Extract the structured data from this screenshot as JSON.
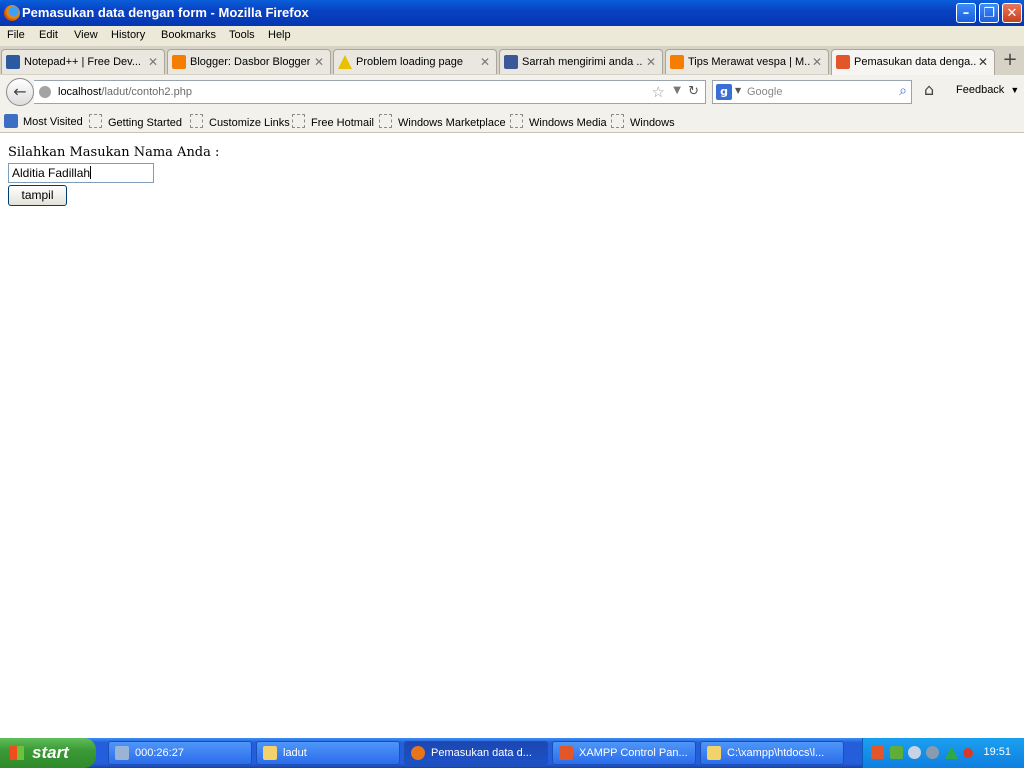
{
  "window": {
    "title": "Pemasukan data dengan form - Mozilla Firefox",
    "minimize": "–",
    "restore": "❐",
    "close": "✕"
  },
  "menu": [
    "File",
    "Edit",
    "View",
    "History",
    "Bookmarks",
    "Tools",
    "Help"
  ],
  "tabs": [
    {
      "label": "Notepad++ | Free Dev...",
      "icon": "sourceforge-icon",
      "color": "#2c5aa0"
    },
    {
      "label": "Blogger: Dasbor Blogger",
      "icon": "blogger-icon",
      "color": "#f57d00"
    },
    {
      "label": "Problem loading page",
      "icon": "warning-icon",
      "color": "#e8c200"
    },
    {
      "label": "Sarrah mengirimi anda ...",
      "icon": "facebook-icon",
      "color": "#3b5998"
    },
    {
      "label": "Tips Merawat vespa | M...",
      "icon": "blogger-icon",
      "color": "#f57d00"
    },
    {
      "label": "Pemasukan data denga...",
      "icon": "xampp-icon",
      "color": "#e2562a"
    }
  ],
  "nav": {
    "url_host": "localhost",
    "url_path": "/ladut/contoh2.php",
    "search_placeholder": "Google",
    "feedback": "Feedback"
  },
  "bookmarks": [
    "Most Visited",
    "Getting Started",
    "Customize Links",
    "Free Hotmail",
    "Windows Marketplace",
    "Windows Media",
    "Windows"
  ],
  "page": {
    "label": "Silahkan Masukan Nama Anda :",
    "input_value": "Alditia Fadillah",
    "button": "tampil"
  },
  "taskbar": {
    "start": "start",
    "tasks": [
      {
        "label": "000:26:27",
        "color": "#9bb4d6"
      },
      {
        "label": "ladut",
        "color": "#f2d36b"
      },
      {
        "label": "Pemasukan data d...",
        "color": "#e8741c"
      },
      {
        "label": "XAMPP Control Pan...",
        "color": "#e2562a"
      },
      {
        "label": "C:\\xampp\\htdocs\\l...",
        "color": "#f2d36b"
      }
    ],
    "clock": "19:51"
  }
}
